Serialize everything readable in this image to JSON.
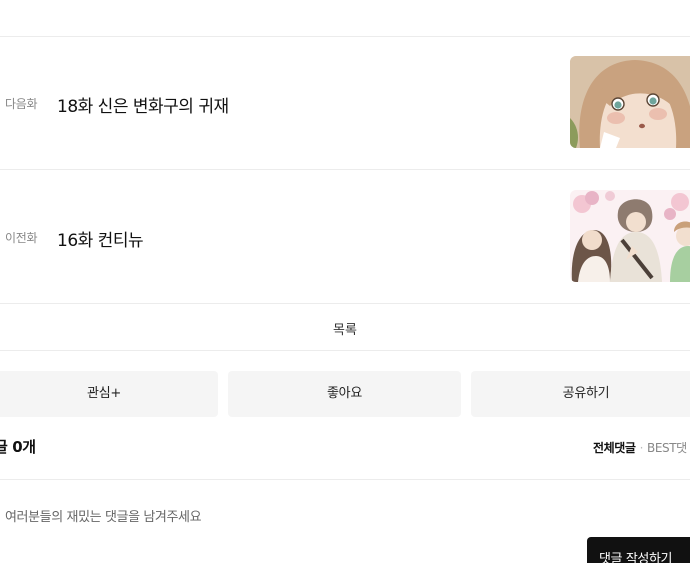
{
  "next_episode": {
    "tag": "다음화",
    "title": "18화 신은 변화구의 귀재",
    "thumbnail": "girl-portrait-illustration"
  },
  "prev_episode": {
    "tag": "이전화",
    "title": "16화 컨티뉴",
    "thumbnail": "group-illustration"
  },
  "list_label": "목록",
  "actions": {
    "interest": "관심+",
    "like": "좋아요",
    "share": "공유하기"
  },
  "comments": {
    "count_label": "글 0개",
    "tab_all": "전체댓글",
    "tab_separator": "·",
    "tab_best": "BEST댓",
    "placeholder": "여러분들의 재밌는 댓글을 남겨주세요",
    "write_button": "댓글 작성하기"
  },
  "colors": {
    "button_bg": "#f5f5f5",
    "write_button_bg": "#111111",
    "divider": "#ececec"
  }
}
